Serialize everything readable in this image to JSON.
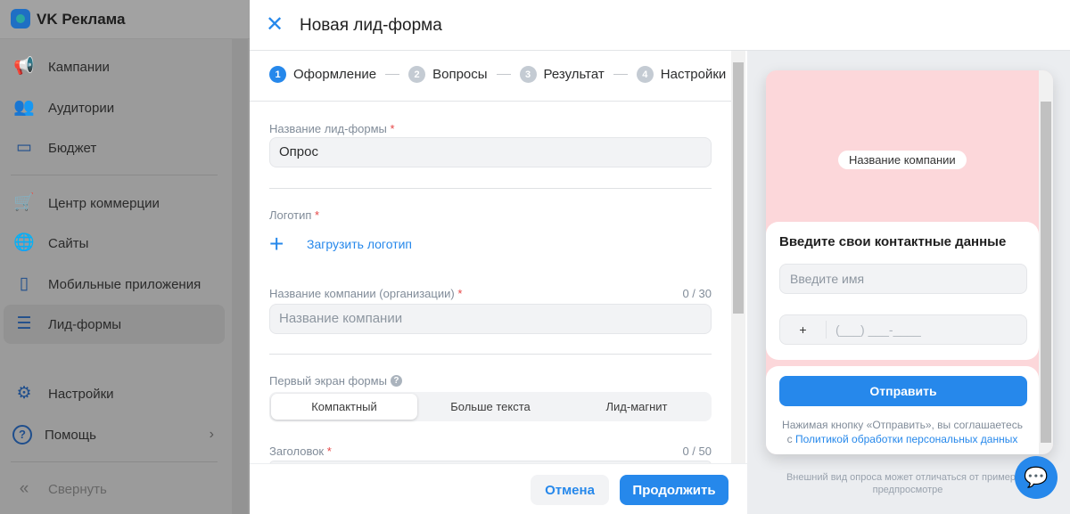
{
  "sidebar": {
    "brand": "VK Реклама",
    "items": [
      {
        "label": "Кампании",
        "icon": "megaphone-icon",
        "glyph": "📢"
      },
      {
        "label": "Аудитории",
        "icon": "users-icon",
        "glyph": "👥"
      },
      {
        "label": "Бюджет",
        "icon": "wallet-icon",
        "glyph": "▭"
      },
      {
        "label": "Центр коммерции",
        "icon": "cart-icon",
        "glyph": "🛒"
      },
      {
        "label": "Сайты",
        "icon": "globe-icon",
        "glyph": "🌐"
      },
      {
        "label": "Мобильные приложения",
        "icon": "phone-icon",
        "glyph": "▯"
      },
      {
        "label": "Лид-формы",
        "icon": "list-icon",
        "glyph": "☰"
      },
      {
        "label": "Настройки",
        "icon": "gear-icon",
        "glyph": "⚙"
      },
      {
        "label": "Помощь",
        "icon": "help-icon",
        "glyph": "?"
      }
    ],
    "collapse": "Свернуть",
    "active": "Лид-формы"
  },
  "modal": {
    "title": "Новая лид-форма",
    "steps": [
      {
        "num": "1",
        "label": "Оформление"
      },
      {
        "num": "2",
        "label": "Вопросы"
      },
      {
        "num": "3",
        "label": "Результат"
      },
      {
        "num": "4",
        "label": "Настройки"
      }
    ],
    "form_name_label": "Название лид-формы",
    "form_name_value": "Опрос",
    "logo_label": "Логотип",
    "upload_logo": "Загрузить логотип",
    "company_label": "Название компании (организации)",
    "company_counter": "0 / 30",
    "company_placeholder": "Название компании",
    "first_screen_label": "Первый экран формы",
    "first_screen_options": [
      "Компактный",
      "Больше текста",
      "Лид-магнит"
    ],
    "first_screen_selected": "Компактный",
    "heading_label": "Заголовок",
    "heading_counter": "0 / 50",
    "required_mark": "*",
    "cancel": "Отмена",
    "continue": "Продолжить"
  },
  "preview": {
    "company_pill": "Название компании",
    "contact_title": "Введите свои контактные данные",
    "name_placeholder": "Введите имя",
    "phone_prefix": "+",
    "phone_mask": "(___) ___-____",
    "submit": "Отправить",
    "consent_text": "Нажимая кнопку «Отправить», вы соглашаетесь",
    "consent_prefix": "с",
    "consent_link": "Политикой обработки персональных данных",
    "note": "Внешний вид опроса может отличаться от примера в предпросмотре"
  },
  "colors": {
    "accent": "#2688eb",
    "preview_bg": "#fcd7da",
    "required": "#e64646"
  }
}
